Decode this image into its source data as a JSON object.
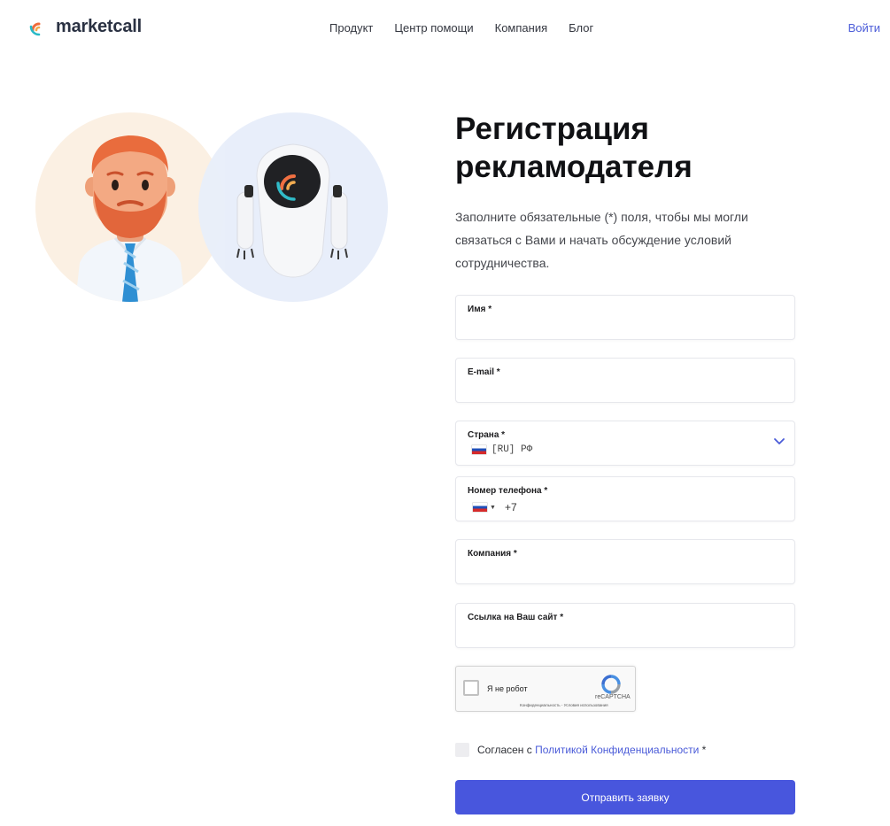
{
  "header": {
    "brand": "marketcall",
    "nav": [
      "Продукт",
      "Центр помощи",
      "Компания",
      "Блог"
    ],
    "login": "Войти"
  },
  "form": {
    "title_line1": "Регистрация",
    "title_line2": "рекламодателя",
    "intro": "Заполните обязательные (*) поля, чтобы мы могли связаться с Вами и начать обсуждение условий сотрудничества.",
    "fields": {
      "name": {
        "label": "Имя *",
        "value": ""
      },
      "email": {
        "label": "E-mail *",
        "value": ""
      },
      "country": {
        "label": "Страна *",
        "value": "[RU] РФ"
      },
      "phone": {
        "label": "Номер телефона *",
        "code": "+7"
      },
      "company": {
        "label": "Компания *",
        "value": ""
      },
      "website": {
        "label": "Ссылка на Ваш сайт *",
        "value": ""
      }
    },
    "captcha": {
      "label": "Я не робот",
      "brand": "reCAPTCHA",
      "links": "Конфиденциальность - Условия использования"
    },
    "consent": {
      "prefix": "Согласен с",
      "link": "Политикой Конфиденциальности",
      "suffix": "*"
    },
    "submit": "Отправить заявку"
  },
  "colors": {
    "accent": "#4856dd",
    "link": "#4a5bd8",
    "man_bg": "#fbf0e3",
    "robot_bg": "#e8eefa"
  },
  "icons": [
    "marketcall-logo-icon",
    "man-avatar-illustration",
    "robot-avatar-illustration",
    "chevron-down-icon",
    "russia-flag-icon",
    "recaptcha-logo-icon"
  ]
}
